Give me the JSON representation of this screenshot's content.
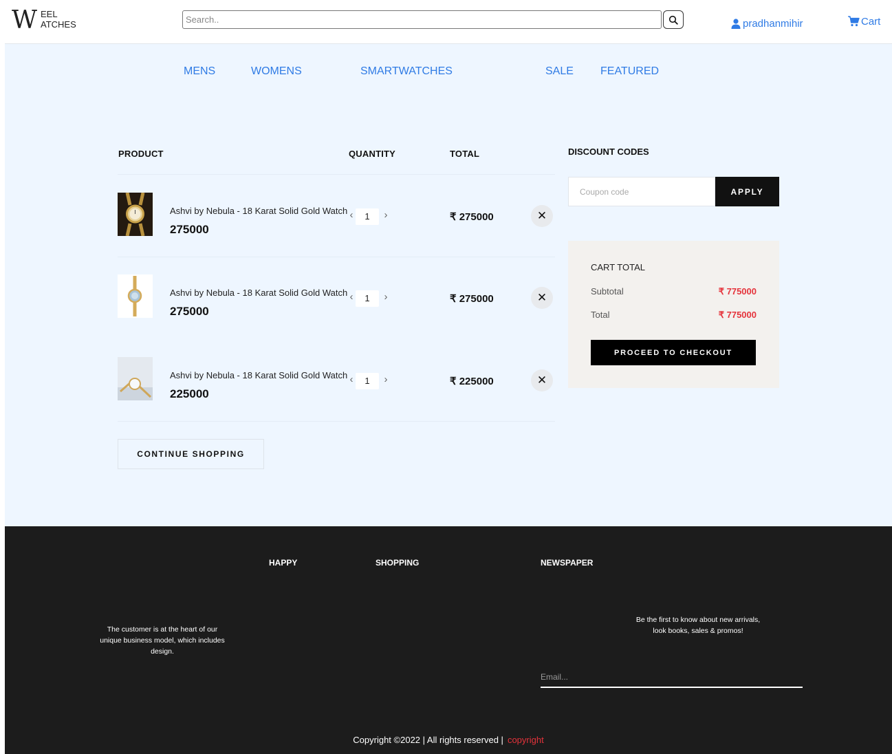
{
  "header": {
    "logo": {
      "big": "W",
      "line1": "EEL",
      "line2": "ATCHES"
    },
    "search_placeholder": "Search..",
    "user_name": "pradhanmihir",
    "cart_label": "Cart"
  },
  "nav": [
    "MENS",
    "WOMENS",
    "SMARTWATCHES",
    "SALE",
    "FEATURED"
  ],
  "table": {
    "headers": {
      "product": "PRODUCT",
      "quantity": "QUANTITY",
      "total": "TOTAL"
    },
    "currency_symbol": "₹",
    "items": [
      {
        "name": "Ashvi by Nebula - 18 Karat Solid Gold Watch",
        "price": "275000",
        "quantity": "1",
        "total": "₹ 275000"
      },
      {
        "name": "Ashvi by Nebula - 18 Karat Solid Gold Watch",
        "price": "275000",
        "quantity": "1",
        "total": "₹ 275000"
      },
      {
        "name": "Ashvi by Nebula - 18 Karat Solid Gold Watch",
        "price": "225000",
        "quantity": "1",
        "total": "₹ 225000"
      }
    ],
    "continue_label": "CONTINUE SHOPPING"
  },
  "discount": {
    "title": "DISCOUNT CODES",
    "coupon_placeholder": "Coupon code",
    "apply_label": "APPLY"
  },
  "cart_total": {
    "title": "CART TOTAL",
    "subtotal_label": "Subtotal",
    "subtotal_value": "₹ 775000",
    "total_label": "Total",
    "total_value": "₹ 775000",
    "checkout_label": "PROCEED TO CHECKOUT"
  },
  "footer": {
    "col1": "HAPPY",
    "col2": "SHOPPING",
    "col3": "NEWSPAPER",
    "about": "The customer is at the heart of our unique business model, which includes design.",
    "newsletter": "Be the first to know about new arrivals, look books, sales & promos!",
    "email_placeholder": "Email...",
    "copyright": "Copyright ©2022 | All rights reserved |",
    "copyright_link": "copyright"
  },
  "colors": {
    "accent": "#2f7be5",
    "price_red": "#e5333b",
    "page_bg": "#eef6ff",
    "footer_bg": "#1c1c1c"
  },
  "icons": [
    "search-icon",
    "user-icon",
    "cart-icon",
    "chevron-left-icon",
    "chevron-right-icon",
    "close-icon"
  ]
}
